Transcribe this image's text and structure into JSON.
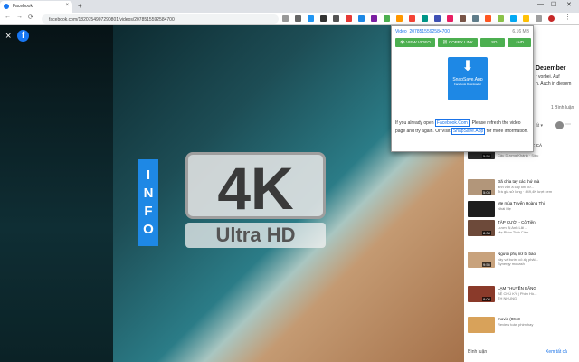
{
  "browser": {
    "tab_title": "Facebook",
    "tab_close": "×",
    "new_tab": "+",
    "url": "facebook.com/1820754907290801/videos/2078515592584700",
    "win_min": "—",
    "win_max": "☐",
    "win_close": "✕"
  },
  "video": {
    "close_icon": "×",
    "fb_logo": "f",
    "info_letters": [
      "I",
      "N",
      "F",
      "O"
    ],
    "title_4k": "4K",
    "title_uhd": "Ultra HD"
  },
  "sidebar": {
    "header": "Dezember",
    "snippet1": "r vorbei. Auf",
    "snippet2": "n. Auch in diesem",
    "comments_count": "1 Bình luận",
    "sort": "ất ▾",
    "suggestions": [
      {
        "title": "PHIM HAY REVIEW: CÁ",
        "channel": "MẬP KHỔNG TRUNG",
        "views": "Cậu Dương Khánh · Siêu",
        "dur": "5:58",
        "color": "#2b2b2b"
      },
      {
        "title": "Đã chia tay các thứ mà",
        "channel": "anh vẫn a cay khi cứ...",
        "views": "Trà giả sử lòng · 449,4K lượt xem",
        "dur": "5:03",
        "color": "#b2967a"
      },
      {
        "title": "Mẹ mùa Tuyển Hoàng Thị",
        "channel": "Nhài Mẹ",
        "views": "",
        "dur": "",
        "color": "#1e1e1e"
      },
      {
        "title": "TẬP CƯỜI - Cô Tiên",
        "channel": "Lươn Bị Anh Lãi ...",
        "views": "Mẹ Phim Tình Cảm",
        "dur": "8:08",
        "color": "#6d4a3a"
      },
      {
        "title": "Người phụ nữ bí bao",
        "channel": "vây và bước cô ấy phải...",
        "views": "Synergy mocash",
        "dur": "9:55",
        "color": "#c8a27c"
      },
      {
        "title": "LẠM THUYỀN BẰNG",
        "channel": "BỆ CHÚ KỲ | Phim Hồ...",
        "views": "TH NHUNG",
        "dur": "8:08",
        "color": "#8a3a2a"
      },
      {
        "title": "movie (0043",
        "channel": "Review toàn phim hay",
        "views": "",
        "dur": "",
        "color": "#d8a25a"
      }
    ],
    "footer_left": "Bình luận",
    "footer_right": "Xem tất cả"
  },
  "popup": {
    "video_title": "Video_2078515592584700",
    "size": "6.16 MB",
    "btn_view": "VIEW VIDEO",
    "btn_copy": "COPPY LINK",
    "btn_sd": "SD",
    "btn_hd": "HD",
    "logo_line1": "SnapSave.App",
    "logo_line2": "Facebook Downloader",
    "msg_pre": "If you already open",
    "msg_link1": "Facebook.Com",
    "msg_mid": ". Please refresh the video page and try again. Or Visit",
    "msg_link2": "SnapSave.App",
    "msg_post": "for more information."
  },
  "colors": {
    "accent": "#1877f2",
    "popup_button": "#4caf50",
    "logo_blue": "#1e88e5"
  }
}
